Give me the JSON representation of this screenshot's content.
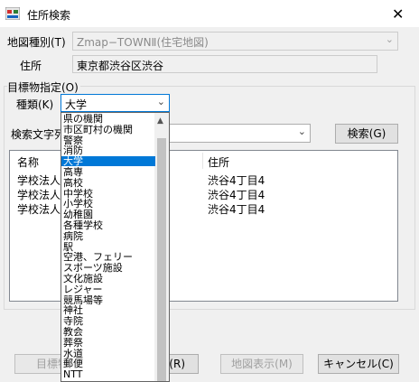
{
  "window": {
    "title": "住所検索",
    "close_glyph": "✕"
  },
  "map_type": {
    "label": "地図種別(T)",
    "value": "Zmap−TOWNⅡ(住宅地図)"
  },
  "address": {
    "label": "住所",
    "value": "東京都渋谷区渋谷"
  },
  "landmark": {
    "group_label": "目標物指定(O)",
    "kind_label": "種類(K)",
    "kind_value": "大学",
    "search_text_label": "検索文字列",
    "search_button": "検索(G)",
    "dropdown_items": [
      "県の機関",
      "市区町村の機関",
      "警察",
      "消防",
      "大学",
      "高専",
      "高校",
      "中学校",
      "小学校",
      "幼稚園",
      "各種学校",
      "病院",
      "駅",
      "空港、フェリー",
      "スポーツ施設",
      "文化施設",
      "レジャー",
      "競馬場等",
      "神社",
      "寺院",
      "教会",
      "葬祭",
      "水道",
      "郵便",
      "NTT"
    ],
    "selected_index": 4
  },
  "results": {
    "columns": [
      "名称",
      "住所"
    ],
    "rows": [
      {
        "name": "学校法人",
        "address": "渋谷4丁目4"
      },
      {
        "name": "学校法人",
        "address": "渋谷4丁目4"
      },
      {
        "name": "学校法人",
        "address": "渋谷4丁目4"
      }
    ]
  },
  "buttons": {
    "landmark": "目標物",
    "r": "(R)",
    "map_display": "地図表示(M)",
    "cancel": "キャンセル(C)"
  }
}
